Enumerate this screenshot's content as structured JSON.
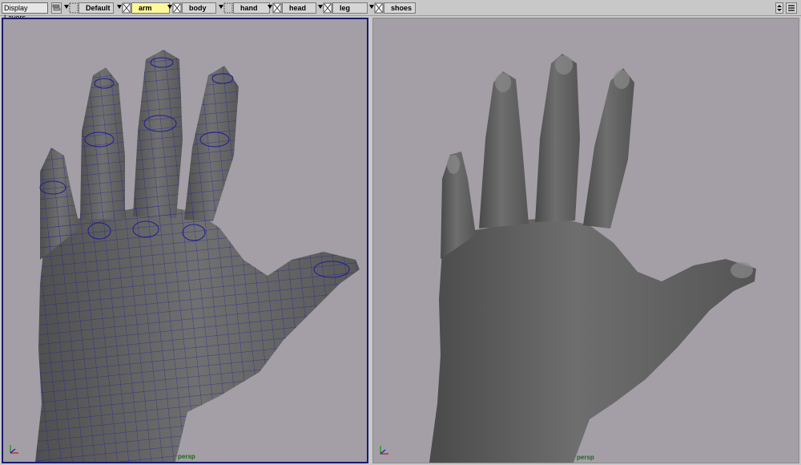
{
  "toolbar": {
    "display_layers_label": "Display Layers",
    "layers": [
      {
        "name": "Default",
        "active": false
      },
      {
        "name": "arm",
        "active": true
      },
      {
        "name": "body",
        "active": false
      },
      {
        "name": "hand",
        "active": false
      },
      {
        "name": "head",
        "active": false
      },
      {
        "name": "leg",
        "active": false
      },
      {
        "name": "shoes",
        "active": false
      }
    ]
  },
  "viewports": {
    "left": {
      "camera": "persp",
      "mode": "wireframe-on-shaded"
    },
    "right": {
      "camera": "persp",
      "mode": "smooth-shaded"
    }
  },
  "colors": {
    "viewport_bg": "#a49fa6",
    "active_border": "#1a1a6e",
    "wireframe": "#1c1c9a",
    "mesh": "#6b6b6b",
    "active_layer": "#fff89a",
    "camera_label": "#1a6b1a"
  }
}
